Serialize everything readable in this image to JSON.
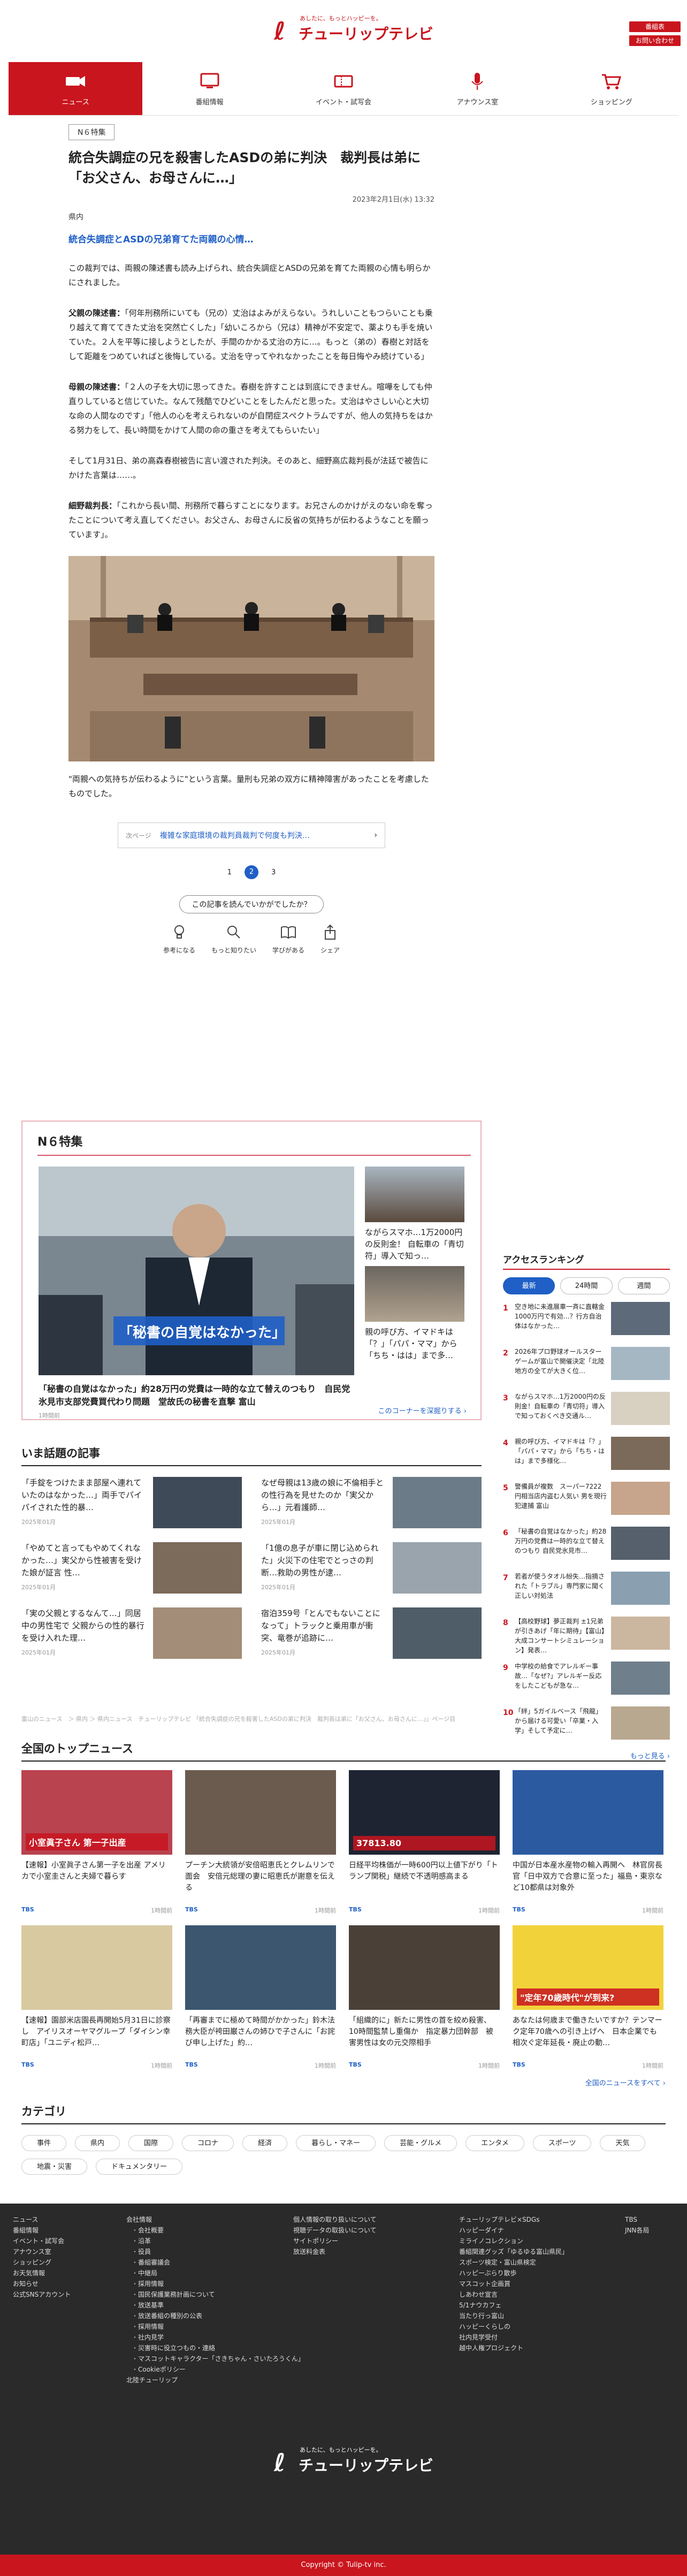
{
  "header": {
    "logo_tagline": "あしたに、もっとハッピーを。",
    "logo_text": "チューリップテレビ",
    "btn_top": "番組表",
    "btn_bottom": "お問い合わせ",
    "colors": {
      "brand": "#c9151e",
      "accent": "#1f5fc6"
    }
  },
  "nav": [
    {
      "label": "ニュース",
      "icon": "camera-icon",
      "active": true
    },
    {
      "label": "番組情報",
      "icon": "tv-icon"
    },
    {
      "label": "イベント・試写会",
      "icon": "ticket-icon"
    },
    {
      "label": "アナウンス室",
      "icon": "microphone-icon"
    },
    {
      "label": "ショッピング",
      "icon": "cart-icon"
    }
  ],
  "article": {
    "badge": "N６特集",
    "title": "統合失調症の兄を殺害したASDの弟に判決　裁判長は弟に「お父さん、お母さんに…」",
    "date": "2023年2月1日(水) 13:32",
    "source": "県内",
    "lead": "統合失調症とASDの兄弟育てた両親の心情…",
    "p1": "この裁判では、両親の陳述書も読み上げられ、統合失調症とASDの兄弟を育てた両親の心情も明らかにされました。",
    "p2_label": "父親の陳述書：",
    "p2": "「何年刑務所にいても（兄の）丈治はよみがえらない。うれしいこともつらいことも乗り越えて育ててきた丈治を突然亡くした」「幼いころから（兄は）精神が不安定で、薬よりも手を焼いていた。２人を平等に接しようとしたが、手間のかかる丈治の方に…。もっと（弟の）春樹と対話をして距離をつめていればと後悔している。丈治を守ってやれなかったことを毎日悔やみ続けている」",
    "p3_label": "母親の陳述書：",
    "p3": "「２人の子を大切に思ってきた。春樹を許すことは到底にできません。喧嘩をしても仲直りしていると信じていた。なんて残酷でひどいことをしたんだと思った。丈治はやさしい心と大切な命の人間なのです」「他人の心を考えられないのが自閉症スペクトラムですが、他人の気持ちをはかる努力をして、長い時間をかけて人間の命の重さを考えてもらいたい」",
    "p4": "そして1月31日、弟の高森春樹被告に言い渡された判決。そのあと、細野高広裁判長が法廷で被告に かけた言葉は……。",
    "p5_label": "細野裁判長：",
    "p5": "「これから長い間、刑務所で暮らすことになります。お兄さんのかけがえのない命を奪ったことについて考え直してください。お父さん、お母さんに反省の気持ちが伝わるようなことを願っています」。",
    "caption": "\"両親への気持ちが伝わるように\"という言葉。量刑も兄弟の双方に精神障害があったことを考慮したものでした。",
    "related_label": "次ページ",
    "related_title": "複雑な家庭環境の裁判員裁判で何度も判決…",
    "pages": [
      "1",
      "2",
      "3"
    ],
    "current_page": 2,
    "ask": "この記事を読んでいかがでしたか？",
    "reactions": [
      {
        "label": "参考になる",
        "icon": "lightbulb-icon"
      },
      {
        "label": "もっと知りたい",
        "icon": "magnifier-icon"
      },
      {
        "label": "学びがある",
        "icon": "book-icon"
      },
      {
        "label": "シェア",
        "icon": "share-icon"
      }
    ]
  },
  "n6": {
    "heading": "N６特集",
    "big_overlay": "「秘書の自覚はなかった」",
    "big_title": "「秘書の自覚はなかった」約28万円の党費は一時的な立て替えのつもり　自民党氷見市支部党費買代わり問題　堂故氏の秘書を直撃 富山",
    "big_time": "1時間前",
    "side": [
      {
        "title": "ながらスマホ…1万2000円の反則金！ 自転車の「青切符」導入で知っ…"
      },
      {
        "title": "親の呼び方、イマドキは「？」「パパ・ママ」から「ちち・はは」まで多…"
      }
    ],
    "more": "このコーナーを深掘りする ›"
  },
  "ranking": {
    "heading": "アクセスランキング",
    "tabs": [
      "最新",
      "24時間",
      "週間"
    ],
    "items": [
      {
        "no": "1",
        "title": "空き地に未進展車一斉に直轄金1000万円で有効…？行方自治体はなかった…"
      },
      {
        "no": "2",
        "title": "2026年プロ野球オールスターゲームが富山で開催決定「北陸地方の全てが大きく位…"
      },
      {
        "no": "3",
        "title": "ながらスマホ…1万2000円の反則金！自転車の「青切符」導入で知っておくべき交通ル…"
      },
      {
        "no": "4",
        "title": "親の呼び方、イマドキは「？」「パパ・ママ」から「ちち・はは」まで多様化…"
      },
      {
        "no": "5",
        "title": "警備員が複数　スーパー7222円相当店内盗む人気い 男を現行犯逮捕 富山"
      },
      {
        "no": "6",
        "title": "「秘書の自覚はなかった」約28万円の党費は一時的な立て替えのつもり 自民党氷見市…"
      },
      {
        "no": "7",
        "title": "若者が使うタオル紛失…指摘された「トラブル」専門家に聞く正しい対処法"
      },
      {
        "no": "8",
        "title": "【高校野球】夢正裁判 ±1兄弟が引きあげ「年に期待」【富山】大成コンサートシミュレーション】発表…"
      },
      {
        "no": "9",
        "title": "中学校の給食でアレルギー事故…「なぜ?」アレルギー反応をしたこどもが急な…"
      },
      {
        "no": "10",
        "title": "「絆」5ガイルベース「飛龍」から届ける可愛い「卒業・入学」そして予定に…"
      }
    ],
    "more": "もっと見る ›"
  },
  "hot": {
    "heading": "いま話題の記事",
    "items": [
      {
        "title": "「手錠をつけたまま部屋へ連れていたのはなかった…」両手でパイパイされた性的暴…",
        "time": "2025年01月"
      },
      {
        "title": "なぜ母親は13歳の娘に不倫相手との性行為を見せたのか「実父から…」元看護師…",
        "time": "2025年01月"
      },
      {
        "title": "「やめてと言ってもやめてくれなかった…」実父から性被害を受けた娘が証言 性…",
        "time": "2025年01月"
      },
      {
        "title": "「1億の息子が車に閉じ込められた」火災下の住宅でとっさの判断…救助の男性が逮…",
        "time": "2025年01月"
      },
      {
        "title": "「実の父親とするなんて…」同居中の男性宅で 父親からの性的暴行を受け入れた理…",
        "time": "2025年01月"
      },
      {
        "title": "宿泊359号「とんでもないことになって」トラックと乗用車が衝突、竜巻が追跡に…",
        "time": "2025年01月"
      }
    ]
  },
  "breadcrumb": "富山のニュース　＞ 県内 ＞ 県内ニュース　チューリップテレビ 「統合失調症の兄を殺害したASDの弟に判決　裁判長は弟に「お父さん、お母さんに…」」ページ目",
  "national": {
    "heading": "全国のトップニュース",
    "items": [
      {
        "title": "【速報】小室眞子さん第一子を出産 アメリカで小室圭さんと夫婦で暮らす",
        "src": "TBS",
        "time": "1時間前",
        "overlay": "小室眞子さん 第一子出産"
      },
      {
        "title": "プーチン大統領が安倍昭恵氏とクレムリンで面会　安倍元総理の妻に昭恵氏が謝意を伝える",
        "src": "TBS",
        "time": "1時間前",
        "overlay": ""
      },
      {
        "title": "日経平均株価が一時600円以上値下がり「トランプ関税」継続で不透明感高まる",
        "src": "TBS",
        "time": "1時間前",
        "overlay": "37813.80"
      },
      {
        "title": "中国が日本産水産物の輸入再開へ　林官房長官「日中双方で合意に至った」福島・東京など10都県は対象外",
        "src": "TBS",
        "time": "1時間前",
        "overlay": ""
      },
      {
        "title": "【速報】園部米店園長再開始5月31日に診察し　アイリスオーヤマグループ「ダイシン幸町店」「ユニディ松戸…",
        "src": "TBS",
        "time": "1時間前",
        "overlay": ""
      },
      {
        "title": "「再審までに極めて時間がかかった」鈴木法務大臣が袴田巌さんの姉ひで子さんに「お詫び申し上げた」約…",
        "src": "TBS",
        "time": "1時間前",
        "overlay": ""
      },
      {
        "title": "「組織的に」新たに男性の首を絞め殺害、10時間監禁し重傷か　指定暴力団幹部　被害男性は女の元交際相手",
        "src": "TBS",
        "time": "1時間前",
        "overlay": ""
      },
      {
        "title": "あなたは何歳まで働きたいですか？テンマーク定年70歳への引き上げへ　日本企業でも相次ぐ定年延長・廃止の動…",
        "src": "TBS",
        "time": "1時間前",
        "overlay": "\"定年70歳時代\"が到来?"
      }
    ],
    "more": "全国のニュースをすべて ›"
  },
  "categories": {
    "heading": "カテゴリ",
    "items": [
      "事件",
      "県内",
      "国際",
      "コロナ",
      "経済",
      "暮らし・マネー",
      "芸能・グルメ",
      "エンタメ",
      "スポーツ",
      "天気",
      "地震・災害",
      "ドキュメンタリー"
    ]
  },
  "footer": {
    "col1": [
      "ニュース",
      "番組情報",
      "イベント・試写会",
      "アナウンス室",
      "ショッピング",
      "お天気情報",
      "お知らせ",
      "公式SNSアカウント"
    ],
    "col2_head": "会社情報",
    "col2": [
      "会社概要",
      "沿革",
      "役員",
      "番組審議会",
      "中継局",
      "採用情報",
      "国民保護業務計画について",
      "放送基準",
      "放送番組の種別の公表",
      "採用情報",
      "社内見学",
      "災害時に役立つもの・連絡",
      "マスコットキャラクター「さきちゃん・さいたろうくん」",
      "Cookieポリシー"
    ],
    "col2_tail": "北陸チューリップ",
    "col3": [
      "個人情報の取り扱いについて",
      "視聴データの取扱いについて",
      "サイトポリシー",
      "放送料金表"
    ],
    "col4": [
      "チューリップテレビ×SDGs",
      "ハッピーダイナ",
      "ミライノコレクション",
      "番組関連グッズ「ゆるゆる富山県民」",
      "スポーツ検定・富山県検定",
      "ハッピーぶらり散歩",
      "マスコット企画賞",
      "しあわせ宣言",
      "5/1ナウカフェ",
      "当たり行っ富山",
      "ハッピーくらしの",
      "社内見学受付",
      "越中人権プロジェクト"
    ],
    "col5": [
      "TBS",
      "JNN各局"
    ],
    "logo_text": "チューリップテレビ",
    "logo_tagline": "あしたに、もっとハッピーを。",
    "copyright": "Copyright © Tulip-tv inc."
  }
}
